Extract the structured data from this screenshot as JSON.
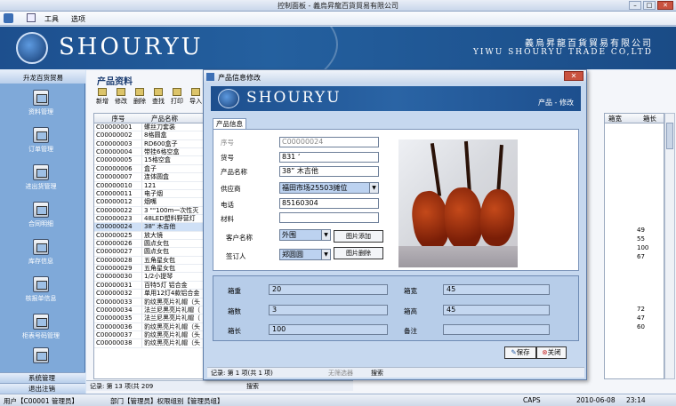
{
  "window": {
    "title": "控制面板 - 義烏昇龍百貨貿易有限公司",
    "menu": [
      "工具",
      "选项"
    ]
  },
  "banner": {
    "brand": "SHOURYU",
    "company_cn": "義烏昇龍百貨貿易有限公司",
    "company_en": "YIWU SHOURYU TRADE CO,LTD"
  },
  "nav": {
    "header": "升龙百货贸易",
    "items": [
      "资料管理",
      "订单管理",
      "进出货管理",
      "合同明细",
      "库存信息",
      "核报单信息",
      "柜表号码管理"
    ],
    "bottom": [
      "系统管理",
      "退出注销"
    ]
  },
  "main": {
    "title": "产品资料",
    "toolbar": [
      "新增",
      "修改",
      "删除",
      "查找",
      "打印",
      "导入"
    ],
    "grid": {
      "headers": [
        "序号",
        "产品名称"
      ],
      "rows": [
        [
          "C00000001",
          "螺丝刀套装"
        ],
        [
          "C00000002",
          "8格圆盒"
        ],
        [
          "C00000003",
          "RD600盒子"
        ],
        [
          "C00000004",
          "带挂6格空盒"
        ],
        [
          "C00000005",
          "15格空盒"
        ],
        [
          "C00000006",
          "盒子"
        ],
        [
          "C00000007",
          "连体圆盒"
        ],
        [
          "C00000010",
          "121"
        ],
        [
          "C00000011",
          "电子烟"
        ],
        [
          "C00000012",
          "烟嘴"
        ],
        [
          "C00000022",
          "3 \"\"100m一次性灭"
        ],
        [
          "C00000023",
          "48LED塑料野营灯"
        ],
        [
          "C00000024",
          "38\" 木吉他"
        ],
        [
          "C00000025",
          "放大镜"
        ],
        [
          "C00000026",
          "圆点女包"
        ],
        [
          "C00000027",
          "圆点女包"
        ],
        [
          "C00000028",
          "五角星女包"
        ],
        [
          "C00000029",
          "五角星女包"
        ],
        [
          "C00000030",
          "1/2小提琴"
        ],
        [
          "C00000031",
          "百特5灯 铝合金"
        ],
        [
          "C00000032",
          "单用12灯4款铝合金"
        ],
        [
          "C00000033",
          "豹纹黑亮片礼帽（头"
        ],
        [
          "C00000034",
          "法兰尼黑亮片礼帽（"
        ],
        [
          "C00000035",
          "法兰尼黑亮片礼帽（"
        ],
        [
          "C00000036",
          "豹纹黑亮片礼帽（头"
        ],
        [
          "C00000037",
          "豹纹黑亮片礼帽（头"
        ],
        [
          "C00000038",
          "豹纹黑亮片礼帽（头"
        ]
      ],
      "right_headers": [
        "箱宽",
        "箱长"
      ],
      "right_values": [
        "49",
        "55",
        "100",
        "67",
        "72",
        "47",
        "60"
      ]
    },
    "records_bar": "记录: 第 13 项(共 209",
    "search": "搜索"
  },
  "dialog": {
    "title": "产品信息修改",
    "brand": "SHOURYU",
    "subtitle": "产品 - 修改",
    "tab": "产品信息",
    "fields": {
      "seq_label": "序号",
      "seq_value": "C00000024",
      "item_no_label": "货号",
      "item_no_value": "831 ‘",
      "name_label": "产品名称",
      "name_value": "38” 木吉他",
      "supplier_label": "供应商",
      "supplier_value": "福田市场25503摊位",
      "phone_label": "电话",
      "phone_value": "85160304",
      "material_label": "材料",
      "material_value": "",
      "customer_label": "客户名称",
      "customer_value": "外围",
      "signer_label": "签订人",
      "signer_value": "郑圆圆"
    },
    "buttons": {
      "add_image": "图片添加",
      "delete_image": "图片删除",
      "save": "保存",
      "close": "关闭"
    },
    "measures": {
      "gross_weight_label": "箱重",
      "gross_weight_value": "20",
      "box_width_label": "箱宽",
      "box_width_value": "45",
      "box_count_label": "箱数",
      "box_count_value": "3",
      "box_height_label": "箱高",
      "box_height_value": "45",
      "box_length_label": "箱长",
      "box_length_value": "100",
      "remark_label": "备注",
      "remark_value": ""
    },
    "records_bar": "记录: 第 1 项(共 1 项)",
    "filter": "无筛选器",
    "search": "搜索"
  },
  "statusbar": {
    "user": "用户【C00001 管理员】",
    "dept": "部门【管理员】权限组别【管理员组】",
    "caps": "CAPS",
    "date": "2010-06-08",
    "time": "23:14"
  }
}
